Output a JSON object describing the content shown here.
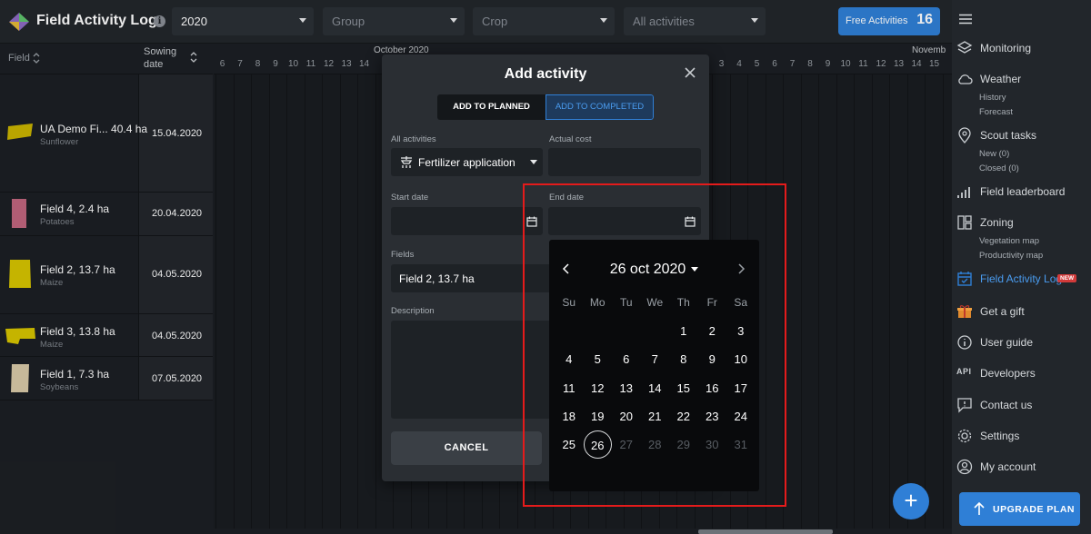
{
  "header": {
    "app_title": "Field Activity Log",
    "year_select": "2020",
    "group_placeholder": "Group",
    "crop_placeholder": "Crop",
    "activities_placeholder": "All activities",
    "free_activities_label": "Free Activities",
    "free_activities_count": "16"
  },
  "table": {
    "field_header": "Field",
    "sowing_header_1": "Sowing",
    "sowing_header_2": "date",
    "month_oct": "October 2020",
    "month_nov": "Novemb",
    "days_left": [
      "6",
      "7",
      "8",
      "9",
      "10",
      "11",
      "12",
      "13",
      "14"
    ],
    "days_right": [
      "3",
      "4",
      "5",
      "6",
      "7",
      "8",
      "9",
      "10",
      "11",
      "12",
      "13",
      "14",
      "15"
    ],
    "rows": [
      {
        "name": "UA Demo Fi... 40.4 ha",
        "crop": "Sunflower",
        "date": "15.04.2020",
        "color": "#c9b400"
      },
      {
        "name": "Field 4, 2.4 ha",
        "crop": "Potatoes",
        "date": "20.04.2020",
        "color": "#c0657e"
      },
      {
        "name": "Field 2, 13.7 ha",
        "crop": "Maize",
        "date": "04.05.2020",
        "color": "#d6c400"
      },
      {
        "name": "Field 3, 13.8 ha",
        "crop": "Maize",
        "date": "04.05.2020",
        "color": "#d6c400"
      },
      {
        "name": "Field 1, 7.3 ha",
        "crop": "Soybeans",
        "date": "07.05.2020",
        "color": "#d8c9a8"
      }
    ]
  },
  "modal": {
    "title": "Add activity",
    "tab_planned": "ADD TO PLANNED",
    "tab_completed": "ADD TO COMPLETED",
    "activities_label": "All activities",
    "activity_value": "Fertilizer application",
    "cost_label": "Actual cost",
    "start_label": "Start date",
    "end_label": "End date",
    "fields_label": "Fields",
    "fields_value": "Field 2, 13.7 ha",
    "description_label": "Description",
    "cancel_label": "CANCEL"
  },
  "calendar": {
    "header": "26 oct 2020",
    "weekdays": [
      "Su",
      "Mo",
      "Tu",
      "We",
      "Th",
      "Fr",
      "Sa"
    ],
    "weeks": [
      [
        "",
        "",
        "",
        "",
        "1",
        "2",
        "3"
      ],
      [
        "4",
        "5",
        "6",
        "7",
        "8",
        "9",
        "10"
      ],
      [
        "11",
        "12",
        "13",
        "14",
        "15",
        "16",
        "17"
      ],
      [
        "18",
        "19",
        "20",
        "21",
        "22",
        "23",
        "24"
      ],
      [
        "25",
        "26",
        "27",
        "28",
        "29",
        "30",
        "31"
      ]
    ],
    "selected": "26",
    "disabled": [
      "27",
      "28",
      "29",
      "30",
      "31"
    ]
  },
  "sidebar": {
    "monitoring": "Monitoring",
    "weather": "Weather",
    "weather_history": "History",
    "weather_forecast": "Forecast",
    "scout_tasks": "Scout tasks",
    "scout_new": "New (0)",
    "scout_closed": "Closed (0)",
    "leaderboard": "Field leaderboard",
    "zoning": "Zoning",
    "zoning_vegetation": "Vegetation map",
    "zoning_productivity": "Productivity map",
    "activity_log": "Field Activity Log",
    "new_badge": "NEW",
    "gift": "Get a gift",
    "guide": "User guide",
    "developers": "Developers",
    "contact": "Contact us",
    "settings": "Settings",
    "account": "My account",
    "upgrade": "UPGRADE PLAN",
    "api_icon_text": "API"
  },
  "colors": {
    "accent": "#2f7fd6",
    "highlight": "#e41b1b",
    "badge": "#d23a3a"
  }
}
